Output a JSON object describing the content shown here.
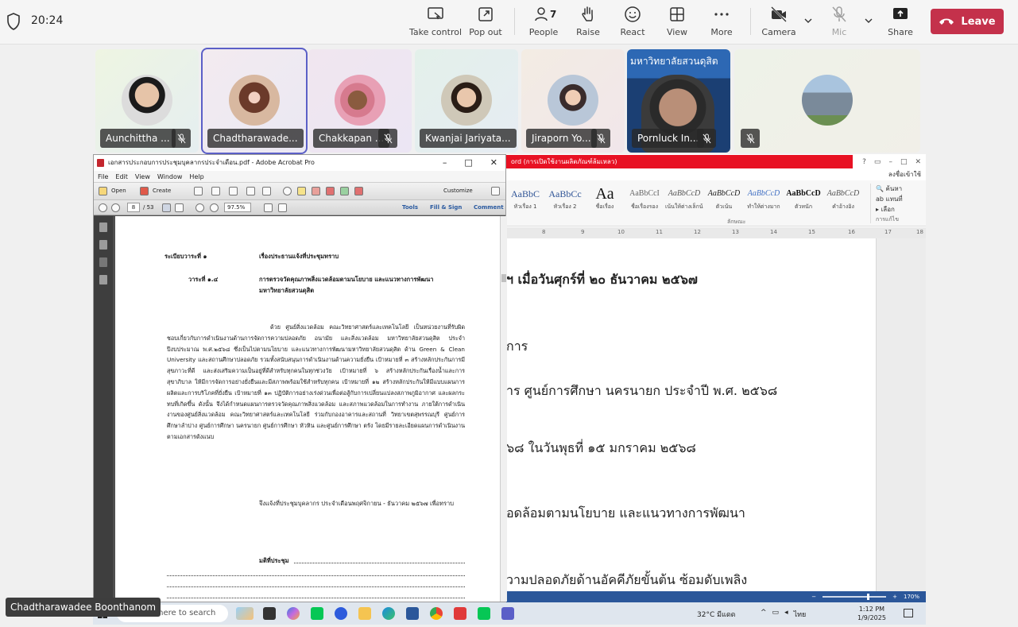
{
  "meeting": {
    "timer": "20:24",
    "toolbar": {
      "take_control": "Take control",
      "pop_out": "Pop out",
      "people": "People",
      "people_count": "7",
      "raise": "Raise",
      "react": "React",
      "view": "View",
      "more": "More",
      "camera": "Camera",
      "mic": "Mic",
      "share": "Share",
      "leave": "Leave"
    },
    "colors": {
      "leave": "#c4314b",
      "active_border": "#5b5fc7"
    },
    "participants": [
      {
        "name": "Aunchittha ...",
        "muted": true
      },
      {
        "name": "Chadtharawade...",
        "muted": false,
        "active": true
      },
      {
        "name": "Chakkapan ...",
        "muted": true
      },
      {
        "name": "Kwanjai Jariyata...",
        "muted": false
      },
      {
        "name": "Jiraporn Yo...",
        "muted": true
      },
      {
        "name": "Pornluck In...",
        "muted": true
      },
      {
        "name": "",
        "muted": true
      }
    ],
    "video_banner": "มหาวิทยาลัยสวนดุสิต",
    "speaker_label": "Chadtharawadee Boonthanom"
  },
  "word": {
    "title": "ord (การเปิดใช้งานผลิตภัณฑ์ล้มเหลว)",
    "window_ctrls": [
      "?",
      "▭",
      "–",
      "□",
      "✕"
    ],
    "login": "ลงชื่อเข้าใช้",
    "styles": [
      {
        "sample": "AaBbC",
        "name": "หัวเรื่อง 1"
      },
      {
        "sample": "AaBbCc",
        "name": "หัวเรื่อง 2"
      },
      {
        "sample": "Aa",
        "name": "ชื่อเรื่อง"
      },
      {
        "sample": "AaBbCcI",
        "name": "ชื่อเรื่องรอง"
      },
      {
        "sample": "AaBbCcD",
        "name": "เน้นให้ต่างเล็กน้อย"
      },
      {
        "sample": "AaBbCcD",
        "name": "ตัวเน้น"
      },
      {
        "sample": "AaBbCcD",
        "name": "ทำให้ต่างมาก"
      },
      {
        "sample": "AaBbCcD",
        "name": "ตัวหนัก"
      },
      {
        "sample": "AaBbCcD",
        "name": "คำอ้างอิง"
      }
    ],
    "styles_group": "ลักษณะ",
    "editing": {
      "find": "ค้นหา",
      "replace": "แทนที่",
      "select": "เลือก",
      "group": "การแก้ไข"
    },
    "ruler": [
      "8",
      "9",
      "10",
      "11",
      "12",
      "13",
      "14",
      "15",
      "16",
      "17",
      "18"
    ],
    "lines": [
      {
        "text": "ฯ เมื่อวันศุกร์ที่ ๒๐ ธันวาคม ๒๕๖๗",
        "bold": true
      },
      {
        "text": "การ",
        "bold": false
      },
      {
        "text": "าร ศูนย์การศึกษา นครนายก ประจำปี พ.ศ. ๒๕๖๘",
        "bold": false
      },
      {
        "text": "๖๘ ในวันพุธที่ ๑๕ มกราคม ๒๕๖๘",
        "bold": false
      },
      {
        "text": "อดล้อมตามนโยบาย และแนวทางการพัฒนา",
        "bold": false
      },
      {
        "text": "วามปลอดภัยด้านอัคคีภัยขั้นต้น ซ้อมดับเพลิง",
        "bold": false
      }
    ],
    "zoom": "170%"
  },
  "acrobat": {
    "title": "เอกสารประกอบการประชุมบุคลากรประจำเดือน.pdf - Adobe Acrobat Pro",
    "menu": [
      "File",
      "Edit",
      "View",
      "Window",
      "Help"
    ],
    "open": "Open",
    "create": "Create",
    "customize": "Customize",
    "page_current": "8",
    "page_total": "/ 53",
    "zoom": "97.5%",
    "tools": "Tools",
    "fill_sign": "Fill & Sign",
    "comment": "Comment"
  },
  "pdf": {
    "agenda_label": "ระเบียบวาระที่ ๑",
    "agenda_title": "เรื่องประธานแจ้งที่ประชุมทราบ",
    "sub_label": "วาระที่ ๑.๔",
    "sub_title_1": "การตรวจวัดคุณภาพสิ่งแวดล้อมตามนโยบาย และแนวทางการพัฒนา",
    "sub_title_2": "มหาวิทยาลัยสวนดุสิต",
    "body": "ด้วย ศูนย์สิ่งแวดล้อม คณะวิทยาศาสตร์และเทคโนโลยี เป็นหน่วยงานที่รับผิดชอบเกี่ยวกับการดำเนินงานด้านการจัดการความปลอดภัย อนามัย และสิ่งแวดล้อม มหาวิทยาลัยสวนดุสิต ประจำปีงบประมาณ พ.ศ.๒๕๖๘ ซึ่งเป็นไปตามนโยบาย และแนวทางการพัฒนามหาวิทยาลัยสวนดุสิต ด้าน Green & Clean University และสถานศึกษาปลอดภัย รวมทั้งสนับสนุนการดำเนินงานด้านความยั่งยืน เป้าหมายที่ ๓ สร้างหลักประกันการมีสุขภาวะที่ดี และส่งเสริมความเป็นอยู่ที่ดีสำหรับทุกคนในทุกช่วงวัย เป้าหมายที่ ๖ สร้างหลักประกันเรื่องน้ำและการสุขาภิบาล ให้มีการจัดการอย่างยั่งยืนและมีสภาพพร้อมใช้สำหรับทุกคน เป้าหมายที่ ๑๒ สร้างหลักประกันให้มีแบบแผนการผลิตและการบริโภคที่ยั่งยืน เป้าหมายที่ ๑๓ ปฏิบัติการอย่างเร่งด่วนเพื่อต่อสู้กับการเปลี่ยนแปลงสภาพภูมิอากาศ และผลกระทบที่เกิดขึ้น ดังนั้น จึงได้กำหนดแผนการตรวจวัดคุณภาพสิ่งแวดล้อม และสภาพแวดล้อมในการทำงาน ภายใต้การดำเนินงานของศูนย์สิ่งแวดล้อม คณะวิทยาศาสตร์และเทคโนโลยี ร่วมกับกองอาคารและสถานที่ วิทยาเขตสุพรรณบุรี ศูนย์การศึกษาลำปาง ศูนย์การศึกษา นครนายก ศูนย์การศึกษา หัวหิน และศูนย์การศึกษา ตรัง โดยมีรายละเอียดแผนการดำเนินงานตามเอกสารดังแนบ",
    "inform": "จึงแจ้งที่ประชุมบุคลากร ประจำเดือนพฤศจิกายน - ธันวาคม ๒๕๖๗ เพื่อทราบ",
    "resolution": "มติที่ประชุม"
  },
  "taskbar": {
    "search_placeholder": "Type here to search",
    "weather": "32°C มีแดด",
    "lang": "ไทย",
    "time": "1:12 PM",
    "date": "1/9/2025"
  }
}
